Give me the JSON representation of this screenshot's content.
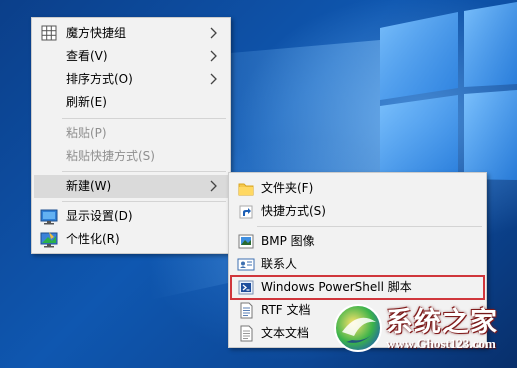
{
  "desktop": {
    "colors": {
      "background": "#0f57b0",
      "menu_bg": "#f2f2f2",
      "highlight": "#dadada",
      "disabled_text": "#8f8f8f",
      "outline": "#d0363c"
    }
  },
  "context_menu": {
    "items": [
      {
        "label": "魔方快捷组",
        "icon": "grid-icon",
        "submenu": true,
        "enabled": true
      },
      {
        "label": "查看(V)",
        "submenu": true,
        "enabled": true
      },
      {
        "label": "排序方式(O)",
        "submenu": true,
        "enabled": true
      },
      {
        "label": "刷新(E)",
        "enabled": true
      },
      {
        "label": "粘贴(P)",
        "enabled": false
      },
      {
        "label": "粘贴快捷方式(S)",
        "enabled": false
      },
      {
        "label": "新建(W)",
        "submenu": true,
        "enabled": true,
        "highlighted": true
      },
      {
        "label": "显示设置(D)",
        "icon": "display-icon",
        "enabled": true
      },
      {
        "label": "个性化(R)",
        "icon": "personalize-icon",
        "enabled": true
      }
    ]
  },
  "new_submenu": {
    "items": [
      {
        "label": "文件夹(F)",
        "icon": "folder-icon"
      },
      {
        "label": "快捷方式(S)",
        "icon": "shortcut-icon"
      },
      {
        "label": "BMP 图像",
        "icon": "bmp-image-icon"
      },
      {
        "label": "联系人",
        "icon": "contact-icon"
      },
      {
        "label": "Windows PowerShell 脚本",
        "icon": "powershell-script-icon",
        "outlined": true
      },
      {
        "label": "RTF 文档",
        "icon": "rtf-document-icon"
      },
      {
        "label": "文本文档",
        "icon": "text-document-icon"
      }
    ]
  },
  "watermark": {
    "title": "系统之家",
    "url": "www.Ghost123.com"
  }
}
